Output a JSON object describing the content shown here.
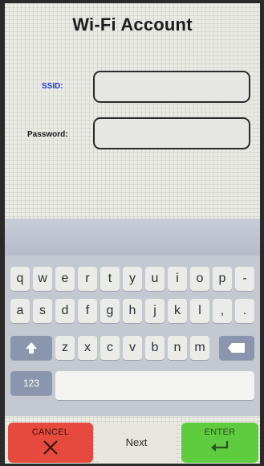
{
  "title": "Wi-Fi Account",
  "form": {
    "ssid_label": "SSID:",
    "password_label": "Password:",
    "ssid_value": "",
    "password_value": ""
  },
  "keyboard": {
    "row1": [
      "q",
      "w",
      "e",
      "r",
      "t",
      "y",
      "u",
      "i",
      "o",
      "p",
      "-"
    ],
    "row2": [
      "a",
      "s",
      "d",
      "f",
      "g",
      "h",
      "j",
      "k",
      "l",
      ",",
      "."
    ],
    "row3": [
      "z",
      "x",
      "c",
      "v",
      "b",
      "n",
      "m"
    ],
    "shift_icon": "shift-arrow-icon",
    "backspace_icon": "backspace-icon",
    "numbers_label": "123"
  },
  "actions": {
    "cancel_label": "CANCEL",
    "next_label": "Next",
    "enter_label": "ENTER"
  },
  "colors": {
    "cancel": "#e64a3e",
    "enter": "#5fcc40",
    "ssid_label": "#2238d8"
  }
}
